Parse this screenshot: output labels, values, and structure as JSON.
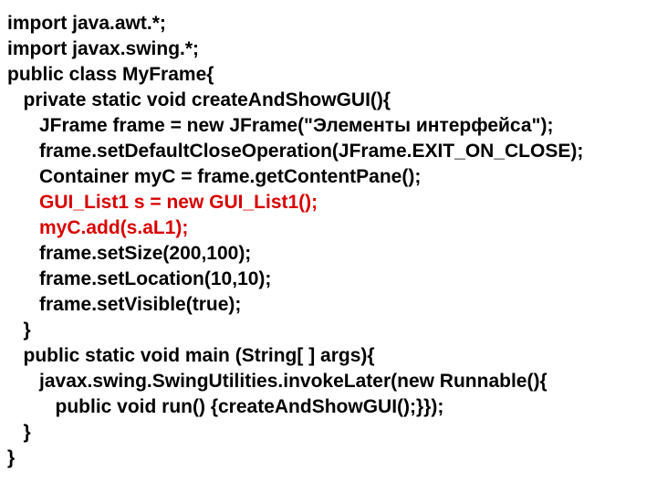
{
  "code": {
    "lines": [
      {
        "indent": 0,
        "text": "import java.awt.*;",
        "highlight": false
      },
      {
        "indent": 0,
        "text": "import javax.swing.*;",
        "highlight": false
      },
      {
        "indent": 0,
        "text": "public class MyFrame{",
        "highlight": false
      },
      {
        "indent": 1,
        "text": "private static void createAndShowGUI(){",
        "highlight": false
      },
      {
        "indent": 2,
        "text": "JFrame frame = new JFrame(\"Элементы интерфейса\");",
        "highlight": false
      },
      {
        "indent": 2,
        "text": "frame.setDefaultCloseOperation(JFrame.EXIT_ON_CLOSE);",
        "highlight": false
      },
      {
        "indent": 2,
        "text": "Container myC = frame.getContentPane();",
        "highlight": false
      },
      {
        "indent": 2,
        "text": "GUI_List1 s = new GUI_List1();",
        "highlight": true
      },
      {
        "indent": 2,
        "text": "myC.add(s.aL1);",
        "highlight": true
      },
      {
        "indent": 2,
        "text": "frame.setSize(200,100);",
        "highlight": false
      },
      {
        "indent": 2,
        "text": "frame.setLocation(10,10);",
        "highlight": false
      },
      {
        "indent": 2,
        "text": "frame.setVisible(true);",
        "highlight": false
      },
      {
        "indent": 1,
        "text": "}",
        "highlight": false
      },
      {
        "indent": 1,
        "text": "public static void main (String[ ] args){",
        "highlight": false
      },
      {
        "indent": 2,
        "text": "javax.swing.SwingUtilities.invokeLater(new Runnable(){",
        "highlight": false
      },
      {
        "indent": 3,
        "text": "public void run() {createAndShowGUI();}});",
        "highlight": false
      },
      {
        "indent": 1,
        "text": "}",
        "highlight": false
      },
      {
        "indent": 0,
        "text": "}",
        "highlight": false
      }
    ],
    "indent_unit": "   "
  }
}
